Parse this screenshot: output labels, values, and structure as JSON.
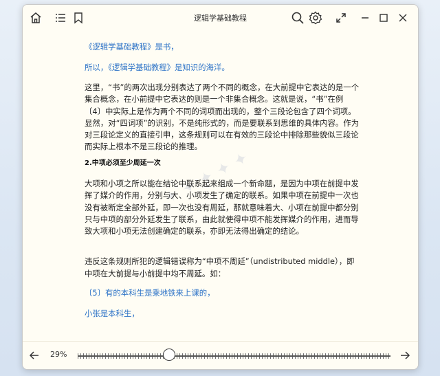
{
  "window": {
    "title": "逻辑学基础教程"
  },
  "content": {
    "paragraphs": [
      {
        "text": "《逻辑学基础教程》是书，",
        "style": "blue"
      },
      {
        "text": "所以，《逻辑学基础教程》是知识的海洋。",
        "style": "blue"
      },
      {
        "text": "这里，“书”的两次出现分别表达了两个不同的概念，在大前提中它表达的是一个集合概念，在小前提中它表达的则是一个非集合概念。这就是说，“书”在例〔4〕中实际上是作为两个不同的词项而出现的，整个三段论包含了四个词项。显然，对“四词项”的识别，不是纯形式的，而是要联系到思维的具体内容。作为对三段论定义的直接引申，这条规则可以在有效的三段论中排除那些貌似三段论而实际上根本不是三段论的推理。",
        "style": "normal"
      },
      {
        "text": "2.中项必须至少周延一次",
        "style": "bold"
      },
      {
        "text": "大项和小项之所以能在结论中联系起来组成一个新命题，是因为中项在前提中发挥了媒介的作用，分别与大、小项发生了确定的联系。如果中项在前提中一次也没有被断定全部外延，即一次也没有周延，那就意味着大、小项在前提中都分别只与中项的部分外延发生了联系，由此就使得中项不能发挥媒介的作用，进而导致大项和小项无法创建确定的联系，亦即无法得出确定的结论。",
        "style": "normal"
      },
      {
        "text": "违反这条规则所犯的逻辑错误称为“中项不周延”（undistributed middle），即中项在大前提与小前提中均不周延。如：",
        "style": "normal"
      },
      {
        "text": "〔5〕有的本科生是乘地铁来上课的，",
        "style": "blue"
      },
      {
        "text": "小张是本科生，",
        "style": "blue"
      }
    ]
  },
  "footer": {
    "progress_label": "29%",
    "progress": 0.29
  },
  "icons": {
    "home": "home-icon",
    "toc": "list-icon",
    "bookmark": "bookmark-icon",
    "search": "search-icon",
    "settings": "gear-icon",
    "fullscreen": "expand-icon",
    "minimize": "minimize-icon",
    "maximize": "maximize-icon",
    "close": "close-icon",
    "prev": "arrow-left-icon",
    "next": "arrow-right-icon"
  }
}
